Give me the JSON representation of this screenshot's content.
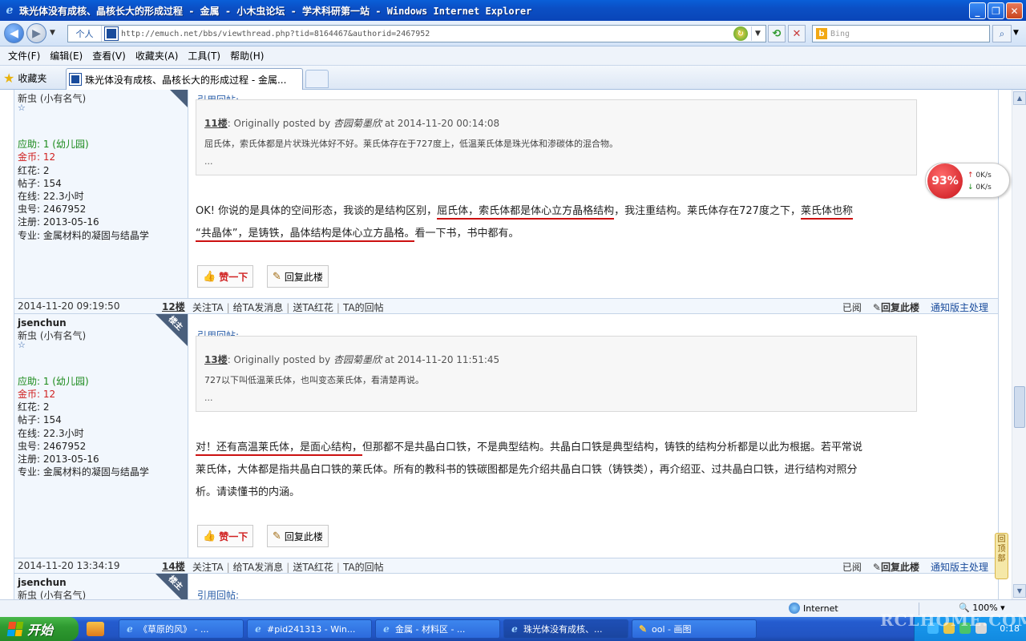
{
  "window": {
    "title": "珠光体没有成核、晶核长大的形成过程 - 金属 - 小木虫论坛 - 学术科研第一站 - Windows Internet Explorer"
  },
  "addressbar": {
    "profile": "个人",
    "url": "http://emuch.net/bbs/viewthread.php?tid=8164467&authorid=2467952",
    "search_placeholder": "Bing"
  },
  "menu": [
    "文件(F)",
    "编辑(E)",
    "查看(V)",
    "收藏夹(A)",
    "工具(T)",
    "帮助(H)"
  ],
  "favorites": {
    "label": "收藏夹",
    "tab_title": "珠光体没有成核、晶核长大的形成过程 - 金属..."
  },
  "posts": [
    {
      "username": "",
      "level": "新虫 (小有名气)",
      "star": "☆",
      "stats": {
        "help": "应助: 1 (幼儿园)",
        "gold": "金币: 12",
        "flower": "红花: 2",
        "posts": "帖子: 154",
        "online": "在线: 22.3小时",
        "uid": "虫号: 2467952",
        "reg": "注册: 2013-05-16",
        "major": "专业: 金属材料的凝固与结晶学"
      },
      "quote_label": "引用回帖:",
      "quote_floor": "11楼",
      "quote_prefix": ": Originally posted by ",
      "quote_author": "杏园菊墨欣",
      "quote_time": " at 2014-11-20 00:14:08",
      "quote_body": "屈氏体，索氏体都是片状珠光体好不好。莱氏体存在于727度上，低温莱氏体是珠光体和渗碳体的混合物。",
      "quote_more": "...",
      "text_a": "OK! 你说的是具体的空间形态，我谈的是结构区别，",
      "text_b": "屈氏体，索氏体都是体心立方晶格结构",
      "text_c": "，我注重结构。莱氏体存在727度之下，",
      "text_d": "莱氏体也称",
      "text_e": "“共晶体”，是铸铁，晶体结构是体心立方晶格。",
      "text_f": "看一下书，书中都有。",
      "like": "赞一下",
      "reply": "回复此楼",
      "footer_time": "2014-11-20 09:19:50",
      "footer_floor": "12楼"
    },
    {
      "username": "jsenchun",
      "level": "新虫 (小有名气)",
      "star": "☆",
      "corner": "楼主",
      "stats": {
        "help": "应助: 1 (幼儿园)",
        "gold": "金币: 12",
        "flower": "红花: 2",
        "posts": "帖子: 154",
        "online": "在线: 22.3小时",
        "uid": "虫号: 2467952",
        "reg": "注册: 2013-05-16",
        "major": "专业: 金属材料的凝固与结晶学"
      },
      "quote_label": "引用回帖:",
      "quote_floor": "13楼",
      "quote_prefix": ": Originally posted by ",
      "quote_author": "杏园菊墨欣",
      "quote_time": " at 2014-11-20 11:51:45",
      "quote_body": "727以下叫低温莱氏体，也叫变态莱氏体，看清楚再说。",
      "quote_more": "...",
      "text_a": "对！还有高温莱氏体，是面心结构，",
      "text_b": "但那都不是共晶白口铁，不是典型结构。共晶白口铁是典型结构，铸铁的结构分析都是以此为根据。若平常说",
      "text_c": "莱氏体，大体都是指共晶白口铁的莱氏体。所有的教科书的铁碳图都是先介绍共晶白口铁（铸铁类），再介绍亚、过共晶白口铁，进行结构对照分",
      "text_d": "析。请读懂书的内涵。",
      "like": "赞一下",
      "reply": "回复此楼",
      "footer_time": "2014-11-20 13:34:19",
      "footer_floor": "14楼"
    },
    {
      "username": "jsenchun",
      "level": "新虫 (小有名气)",
      "corner": "楼主",
      "quote_label": "引用回帖:"
    }
  ],
  "footer_links": [
    "关注TA",
    "给TA发消息",
    "送TA红花",
    "TA的回帖"
  ],
  "footer_right": {
    "read": "已阅",
    "reply": "回复此楼",
    "report": "通知版主处理"
  },
  "netwidget": {
    "percent": "93%",
    "up": "0K/s",
    "down": "0K/s"
  },
  "backtop": "回顶部",
  "status": {
    "zone": "Internet",
    "zoom": "100%"
  },
  "taskbar": {
    "start": "开始",
    "tasks": [
      "《草原的风》 - ...",
      "#pid241313 - Win...",
      "金属 - 材料区 - ...",
      "珠光体没有成核、...",
      "ool - 画图"
    ],
    "clock": "0:18"
  },
  "watermark": "RCLHOME.COM",
  "colors": {
    "titlebar": "#0b4fc4",
    "underline": "#cc1010",
    "link": "#1a4c9c"
  }
}
